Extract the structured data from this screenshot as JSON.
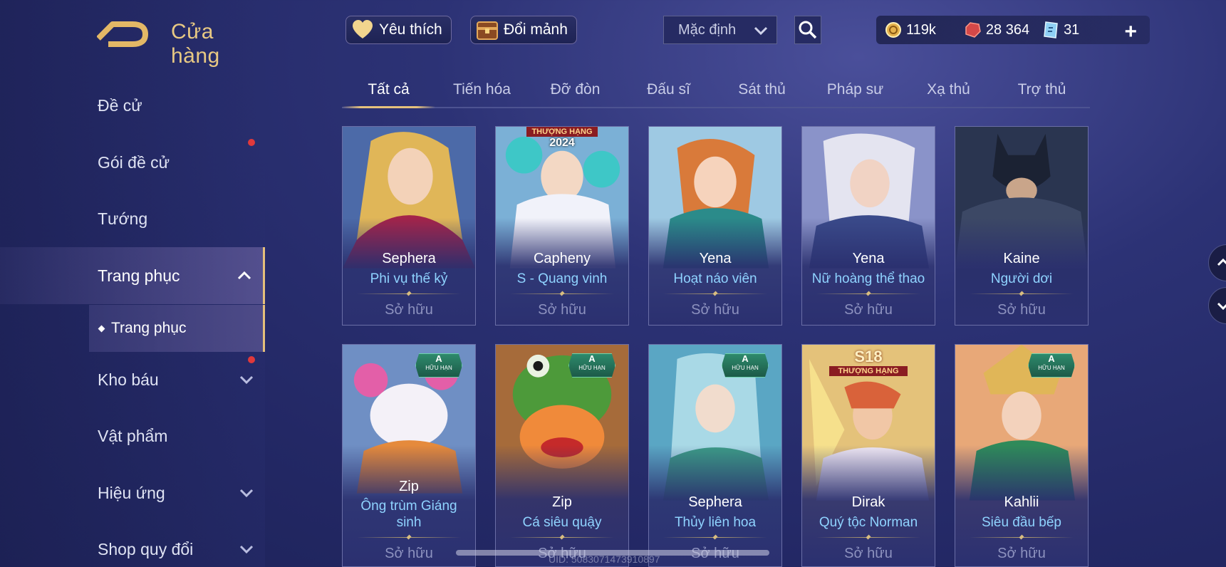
{
  "header": {
    "title": "Cửa hàng"
  },
  "topbar": {
    "favorites_label": "Yêu thích",
    "exchange_label": "Đổi mảnh",
    "sort_value": "Mặc định",
    "currencies": {
      "gold": "119k",
      "gems": "28 364",
      "vouchers": "31"
    },
    "add_symbol": "+"
  },
  "sidebar": {
    "items": [
      {
        "label": "Đề cử"
      },
      {
        "label": "Gói đề cử"
      },
      {
        "label": "Tướng"
      },
      {
        "label": "Trang phục"
      },
      {
        "label": "Kho báu"
      },
      {
        "label": "Vật phẩm"
      },
      {
        "label": "Hiệu ứng"
      },
      {
        "label": "Shop quy đổi"
      }
    ],
    "sub_item": "Trang phục"
  },
  "tabs": [
    "Tất cả",
    "Tiến hóa",
    "Đỡ đòn",
    "Đấu sĩ",
    "Sát thủ",
    "Pháp sư",
    "Xạ thủ",
    "Trợ thủ"
  ],
  "cards": [
    {
      "hero": "Sephera",
      "skin": "Phi vụ thế kỷ",
      "status": "Sở hữu"
    },
    {
      "hero": "Capheny",
      "skin": "S - Quang vinh",
      "status": "Sở hữu",
      "rank_text": "THƯỢNG HẠNG",
      "rank_year": "2024"
    },
    {
      "hero": "Yena",
      "skin": "Hoạt náo viên",
      "status": "Sở hữu"
    },
    {
      "hero": "Yena",
      "skin": "Nữ hoàng thể thao",
      "status": "Sở hữu"
    },
    {
      "hero": "Kaine",
      "skin": "Người dơi",
      "status": "Sở hữu"
    },
    {
      "hero": "Zip",
      "skin_line1": "Ông trùm Giáng",
      "skin_line2": "sinh",
      "status": "Sở hữu",
      "badge_grade": "A",
      "badge_text": "HỮU HẠN"
    },
    {
      "hero": "Zip",
      "skin": "Cá siêu quậy",
      "status": "Sở hữu",
      "badge_grade": "A",
      "badge_text": "HỮU HẠN"
    },
    {
      "hero": "Sephera",
      "skin": "Thủy liên hoa",
      "status": "Sở hữu",
      "badge_grade": "A",
      "badge_text": "HỮU HẠN"
    },
    {
      "hero": "Dirak",
      "skin": "Quý tộc Norman",
      "status": "Sở hữu",
      "rank_season": "S18",
      "rank_text": "THƯỢNG HẠNG"
    },
    {
      "hero": "Kahlii",
      "skin": "Siêu đầu bếp",
      "status": "Sở hữu",
      "badge_grade": "A",
      "badge_text": "HỮU HẠN"
    }
  ],
  "footer": {
    "uid": "UID: 5083071473910897"
  },
  "colors": {
    "accent_gold": "#e6c27c",
    "skin_name": "#8fd3ff",
    "limited_badge": "#2e8a6c",
    "notification": "#e0393b"
  }
}
